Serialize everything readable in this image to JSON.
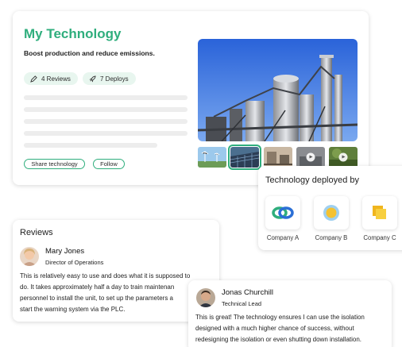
{
  "technology": {
    "title": "My Technology",
    "subtitle": "Boost production and reduce emissions.",
    "reviews_badge": "4 Reviews",
    "deploys_badge": "7 Deploys",
    "share_label": "Share technology",
    "follow_label": "Follow",
    "accent_color": "#2fae7d",
    "badge_bg": "#e8f6ef"
  },
  "deployed": {
    "title": "Technology deployed by",
    "companies": [
      {
        "name": "Company A"
      },
      {
        "name": "Company B"
      },
      {
        "name": "Company C"
      }
    ]
  },
  "reviews": {
    "heading": "Reviews",
    "items": [
      {
        "name": "Mary Jones",
        "role": "Director of Operations",
        "lines": [
          "This is relatively easy to use and does what it is supposed to",
          "do. It takes approximately half a day to train maintenan",
          "personnel to install the unit, to set up the parameters a",
          "start the warning system via the PLC."
        ]
      },
      {
        "name": "Jonas Churchill",
        "role": "Technical Lead",
        "lines": [
          "This is great! The technology ensures I can use the isolation",
          "designed with a much higher chance of success, without",
          "redesigning the isolation or even shutting down installation."
        ]
      }
    ]
  }
}
